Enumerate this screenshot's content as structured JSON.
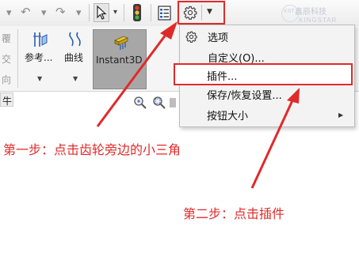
{
  "toolbar": {
    "icons": [
      "undo-icon",
      "redo-icon",
      "pointer-icon",
      "traffic-light-icon",
      "properties-icon",
      "gear-icon",
      "dropdown-arrow-icon"
    ],
    "accent_color": "#e02a2a"
  },
  "watermark": {
    "brand_abbr": "KST",
    "brand_cn": "鑫辰科技",
    "brand_en": "KINGSTAR"
  },
  "ribbon": {
    "side_chars": [
      "覆",
      "交",
      "向"
    ],
    "reference_label": "参考...",
    "curve_label": "曲线",
    "instant3d_label": "Instant3D",
    "tab_label": "牛"
  },
  "menu": {
    "items": [
      {
        "label": "选项",
        "icon": "gear-icon"
      },
      {
        "label": "自定义(O)..."
      },
      {
        "label": "插件..."
      },
      {
        "label": "保存/恢复设置..."
      },
      {
        "label": "按钮大小",
        "submenu": true
      }
    ]
  },
  "annotations": {
    "step1": "第一步：点击齿轮旁边的小三角",
    "step2": "第二步：点击插件"
  }
}
